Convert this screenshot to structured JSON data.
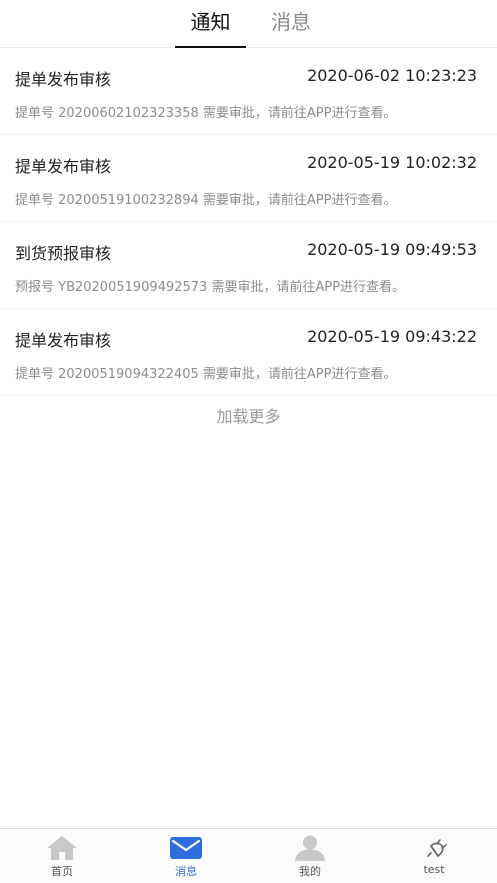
{
  "tabs": [
    {
      "label": "通知",
      "active": true
    },
    {
      "label": "消息",
      "active": false
    }
  ],
  "notices": [
    {
      "title": "提单发布审核",
      "time": "2020-06-02 10:23:23",
      "desc": "提单号 20200602102323358 需要审批，请前往APP进行查看。"
    },
    {
      "title": "提单发布审核",
      "time": "2020-05-19 10:02:32",
      "desc": "提单号 20200519100232894 需要审批，请前往APP进行查看。"
    },
    {
      "title": "到货预报审核",
      "time": "2020-05-19 09:49:53",
      "desc": "预报号 YB2020051909492573 需要审批，请前往APP进行查看。"
    },
    {
      "title": "提单发布审核",
      "time": "2020-05-19 09:43:22",
      "desc": "提单号 20200519094322405 需要审批，请前往APP进行查看。"
    }
  ],
  "load_more_label": "加载更多",
  "bottom_nav": [
    {
      "label": "首页",
      "icon": "home-icon",
      "active": false
    },
    {
      "label": "消息",
      "icon": "mail-icon",
      "active": true
    },
    {
      "label": "我的",
      "icon": "user-icon",
      "active": false
    },
    {
      "label": "test",
      "icon": "plug-icon",
      "active": false
    }
  ],
  "colors": {
    "accent": "#2f6ede",
    "inactive_icon": "#c8c8c8",
    "text_primary": "#222222",
    "text_secondary": "#8c8c8c"
  }
}
